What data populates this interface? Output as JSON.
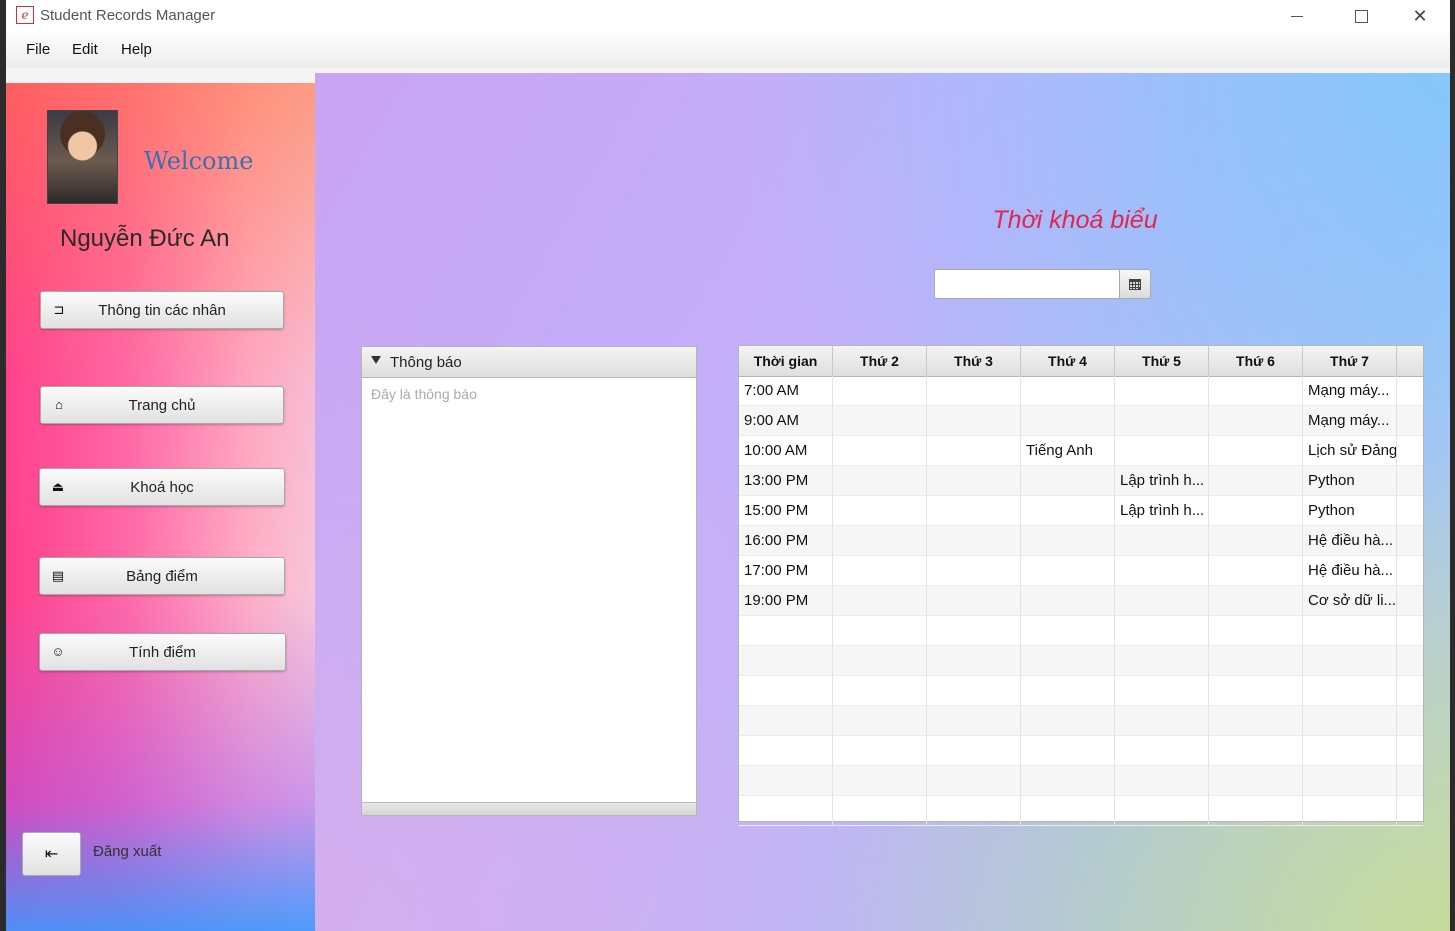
{
  "window": {
    "title": "Student Records Manager"
  },
  "menu": [
    "File",
    "Edit",
    "Help"
  ],
  "sidebar": {
    "welcome": "Welcome",
    "username": "Nguyễn Đức An",
    "buttons": [
      {
        "label": "Thông tin các nhân",
        "icon": "id-card-icon"
      },
      {
        "label": "Trang chủ",
        "icon": "home-icon"
      },
      {
        "label": "Khoá học",
        "icon": "course-icon"
      },
      {
        "label": "Bảng điểm",
        "icon": "grade-sheet-icon"
      },
      {
        "label": "Tính điểm",
        "icon": "calculator-icon"
      }
    ],
    "logout": "Đăng xuất"
  },
  "main": {
    "title": "Thời khoá biểu",
    "date_value": "",
    "notification": {
      "title": "Thông báo",
      "placeholder": "Đây là thông báo"
    },
    "schedule": {
      "headers": [
        "Thời gian",
        "Thứ 2",
        "Thứ 3",
        "Thứ 4",
        "Thứ 5",
        "Thứ 6",
        "Thứ 7"
      ],
      "rows": [
        [
          "7:00 AM",
          "",
          "",
          "",
          "",
          "",
          "Mạng máy..."
        ],
        [
          "9:00 AM",
          "",
          "",
          "",
          "",
          "",
          "Mạng máy..."
        ],
        [
          "10:00 AM",
          "",
          "",
          "Tiếng Anh",
          "",
          "",
          "Lịch sử Đảng"
        ],
        [
          "13:00 PM",
          "",
          "",
          "",
          "Lập trình h...",
          "",
          "Python"
        ],
        [
          "15:00 PM",
          "",
          "",
          "",
          "Lập trình h...",
          "",
          "Python"
        ],
        [
          "16:00 PM",
          "",
          "",
          "",
          "",
          "",
          "Hệ điều hà..."
        ],
        [
          "17:00 PM",
          "",
          "",
          "",
          "",
          "",
          "Hệ điều hà..."
        ],
        [
          "19:00 PM",
          "",
          "",
          "",
          "",
          "",
          "Cơ sở dữ li..."
        ],
        [
          "",
          "",
          "",
          "",
          "",
          "",
          ""
        ],
        [
          "",
          "",
          "",
          "",
          "",
          "",
          ""
        ],
        [
          "",
          "",
          "",
          "",
          "",
          "",
          ""
        ],
        [
          "",
          "",
          "",
          "",
          "",
          "",
          ""
        ],
        [
          "",
          "",
          "",
          "",
          "",
          "",
          ""
        ],
        [
          "",
          "",
          "",
          "",
          "",
          "",
          ""
        ],
        [
          "",
          "",
          "",
          "",
          "",
          "",
          ""
        ]
      ]
    }
  },
  "colors": {
    "title_red": "#e2264c",
    "welcome_blue": "#3b6fb4"
  }
}
